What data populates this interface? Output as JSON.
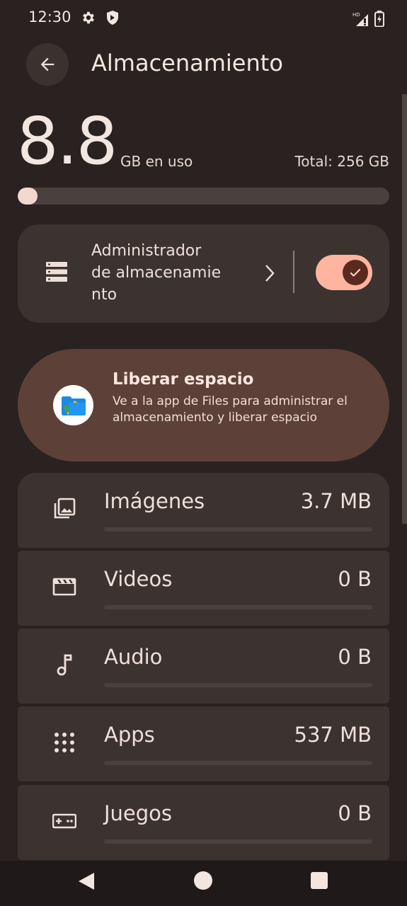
{
  "status_bar": {
    "time": "12:30",
    "left_icons": [
      "gear-icon",
      "shield-icon"
    ],
    "right_icons": [
      "hd-signal-icon",
      "battery-charging-icon"
    ],
    "network_badge": "HD"
  },
  "header": {
    "back_icon": "arrow-back-icon",
    "title": "Almacenamiento"
  },
  "usage": {
    "used_value": "8.8",
    "used_unit": "GB en uso",
    "total_text": "Total: 256 GB",
    "fraction_used": 0.034
  },
  "storage_manager": {
    "icon": "storage-list-icon",
    "label": "Administrador de almacenamiento",
    "label_line1": "Administrador",
    "label_line2": "de almacenamie",
    "label_line3": "nto",
    "enabled": true
  },
  "free_space": {
    "icon": "files-app-icon",
    "title": "Liberar espacio",
    "description": "Ve a la app de Files para administrar el almacenamiento y liberar espacio"
  },
  "categories": [
    {
      "icon": "images-icon",
      "label": "Imágenes",
      "size": "3.7 MB",
      "fraction": 0.0
    },
    {
      "icon": "video-icon",
      "label": "Videos",
      "size": "0 B",
      "fraction": 0.0
    },
    {
      "icon": "music-note-icon",
      "label": "Audio",
      "size": "0 B",
      "fraction": 0.0
    },
    {
      "icon": "apps-grid-icon",
      "label": "Apps",
      "size": "537 MB",
      "fraction": 0.0
    },
    {
      "icon": "gamepad-icon",
      "label": "Juegos",
      "size": "0 B",
      "fraction": 0.0
    }
  ],
  "nav_bar": {
    "icons": [
      "back-triangle-icon",
      "home-circle-icon",
      "recents-square-icon"
    ]
  },
  "colors": {
    "background": "#2a2220",
    "card": "#3c3331",
    "accent": "#ffb4a0",
    "free_card": "#5d4037"
  }
}
